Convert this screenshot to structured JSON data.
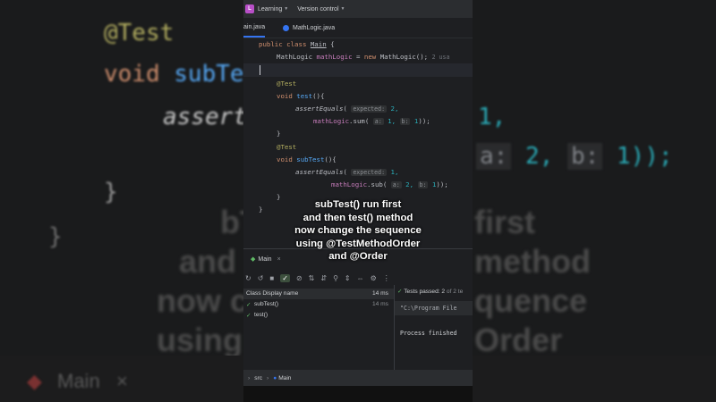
{
  "window": {
    "project_badge": "L",
    "project_name": "Learning",
    "vcs_menu": "Version control"
  },
  "tabs": [
    {
      "label": "ain.java"
    },
    {
      "label": "MathLogic.java"
    }
  ],
  "editor": {
    "lines": [
      {
        "t": "public class Main {"
      },
      {
        "t": "MathLogic mathLogic = new MathLogic();",
        "hint": "2 usa"
      },
      {
        "t": "@Test"
      },
      {
        "t": "void test(){"
      },
      {
        "t": "assertEquals(",
        "hint": "expected:",
        "tail": "2,"
      },
      {
        "t": "mathLogic.sum(",
        "hint_a": "a:",
        "a": "1,",
        "hint_b": "b:",
        "b": "1));"
      },
      {
        "t": "}"
      },
      {
        "t": "@Test"
      },
      {
        "t": "void subTest(){"
      },
      {
        "t": "assertEquals(",
        "hint": "expected:",
        "tail": "1,"
      },
      {
        "t": "mathLogic.sub(",
        "hint_a": "a:",
        "a": "2,",
        "hint_b": "b:",
        "b": "1));"
      },
      {
        "t": "}"
      },
      {
        "t": "}"
      }
    ]
  },
  "overlay_caption": [
    "subTest() run first",
    "and then test() method",
    "now change the sequence",
    "using @TestMethodOrder",
    "and @Order"
  ],
  "run_panel": {
    "tab_label": "Main",
    "tree_header": "Class Display name",
    "tree_header_time": "14 ms",
    "tests": [
      {
        "name": "subTest()",
        "time": "14 ms"
      },
      {
        "name": "test()",
        "time": ""
      }
    ],
    "passed_text": "Tests passed: 2",
    "passed_tail": "of 2 te",
    "console_cmd": "\"C:\\Program File",
    "console_finished": "Process finished"
  },
  "statusbar": {
    "crumbs": [
      "src",
      "Main"
    ]
  },
  "background": {
    "code": {
      "ann": "@Test",
      "void": "void",
      "method": "subTest",
      "assert": "assert",
      "right_frag": "1,",
      "right_a": "a:",
      "right_a_val": "2,",
      "right_b": "b:",
      "right_b_val": "1));",
      "brace": "}"
    },
    "caption_left": [
      "bT",
      "and",
      "now c",
      "using"
    ],
    "caption_right": [
      "first",
      "method",
      "quence",
      "Order"
    ],
    "bottom_tab": "Main"
  },
  "colors": {
    "keyword": "#cf8e6d",
    "annotation": "#b3ae60",
    "method": "#56a8f5",
    "field": "#c77dbb",
    "number": "#2aacb8",
    "accent": "#3574f0",
    "pass": "#5fb865",
    "project_badge": "#b84fc7"
  }
}
